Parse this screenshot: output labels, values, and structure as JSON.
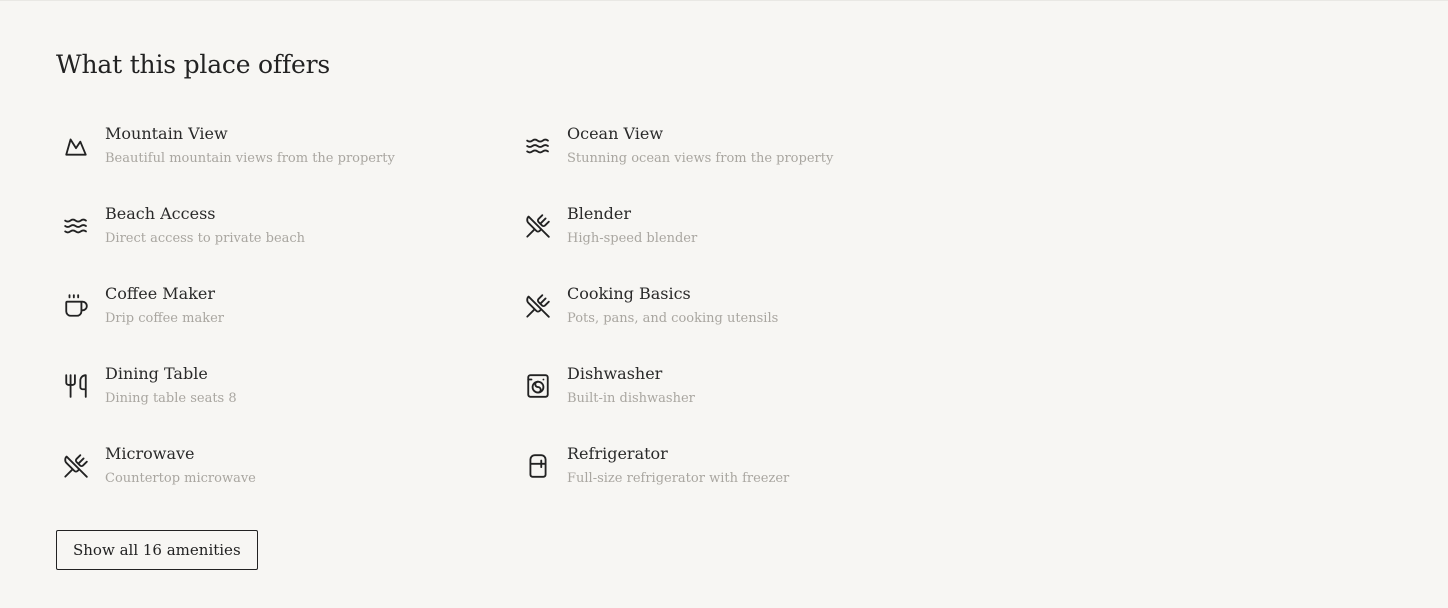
{
  "section": {
    "title": "What this place offers"
  },
  "amenities": [
    {
      "name": "Mountain View",
      "description": "Beautiful mountain views from the property",
      "icon": "mountain-icon"
    },
    {
      "name": "Ocean View",
      "description": "Stunning ocean views from the property",
      "icon": "waves-icon"
    },
    {
      "name": "Beach Access",
      "description": "Direct access to private beach",
      "icon": "waves-icon"
    },
    {
      "name": "Blender",
      "description": "High-speed blender",
      "icon": "utensils-crossed-icon"
    },
    {
      "name": "Coffee Maker",
      "description": "Drip coffee maker",
      "icon": "coffee-icon"
    },
    {
      "name": "Cooking Basics",
      "description": "Pots, pans, and cooking utensils",
      "icon": "utensils-crossed-icon"
    },
    {
      "name": "Dining Table",
      "description": "Dining table seats 8",
      "icon": "utensils-icon"
    },
    {
      "name": "Dishwasher",
      "description": "Built-in dishwasher",
      "icon": "washing-machine-icon"
    },
    {
      "name": "Microwave",
      "description": "Countertop microwave",
      "icon": "utensils-crossed-icon"
    },
    {
      "name": "Refrigerator",
      "description": "Full-size refrigerator with freezer",
      "icon": "refrigerator-icon"
    }
  ],
  "show_all_button": {
    "label": "Show all 16 amenities"
  },
  "colors": {
    "background": "#f7f6f3",
    "text": "#222222",
    "muted_text": "#a9a6a0"
  }
}
